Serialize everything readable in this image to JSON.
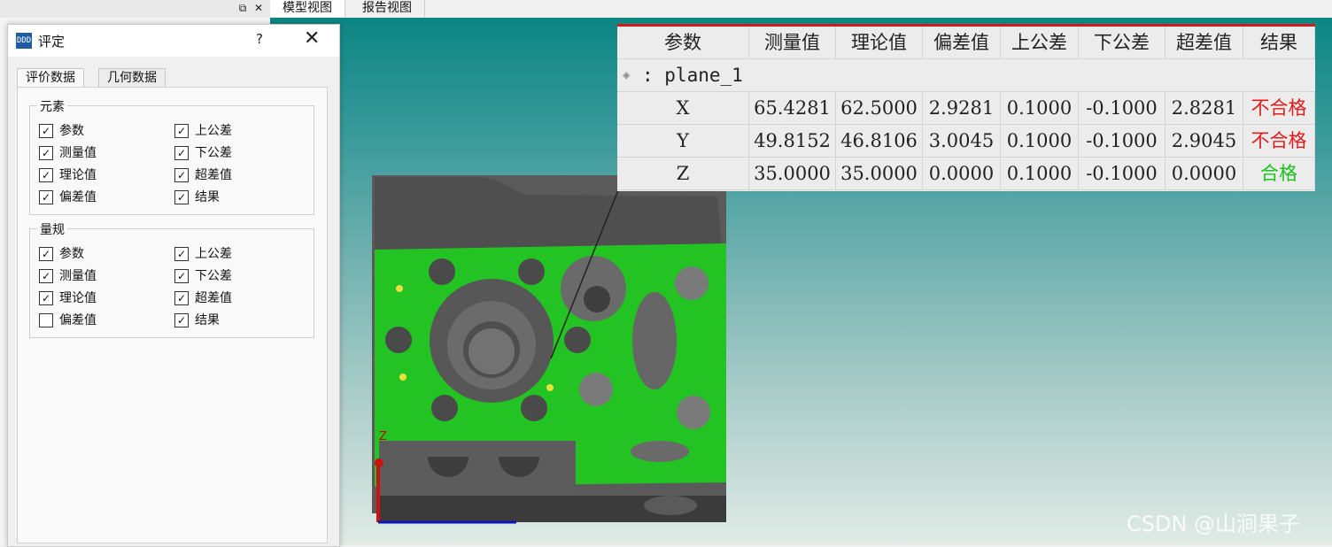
{
  "view_tabs": [
    "模型视图",
    "报告视图"
  ],
  "dock": {
    "restore_icon": "restore-icon",
    "close_icon": "close-icon"
  },
  "dialog": {
    "title": "评定",
    "help": "?",
    "tabs": [
      "评价数据",
      "几何数据"
    ],
    "element_group": {
      "title": "元素",
      "items": [
        {
          "label": "参数",
          "checked": true
        },
        {
          "label": "测量值",
          "checked": true
        },
        {
          "label": "理论值",
          "checked": true
        },
        {
          "label": "偏差值",
          "checked": true
        },
        {
          "label": "上公差",
          "checked": true
        },
        {
          "label": "下公差",
          "checked": true
        },
        {
          "label": "超差值",
          "checked": true
        },
        {
          "label": "结果",
          "checked": true
        }
      ]
    },
    "gauge_group": {
      "title": "量规",
      "items": [
        {
          "label": "参数",
          "checked": true
        },
        {
          "label": "测量值",
          "checked": true
        },
        {
          "label": "理论值",
          "checked": true
        },
        {
          "label": "偏差值",
          "checked": false
        },
        {
          "label": "上公差",
          "checked": true
        },
        {
          "label": "下公差",
          "checked": true
        },
        {
          "label": "超差值",
          "checked": true
        },
        {
          "label": "结果",
          "checked": true
        }
      ]
    }
  },
  "result_table": {
    "headers": [
      "参数",
      "测量值",
      "理论值",
      "偏差值",
      "上公差",
      "下公差",
      "超差值",
      "结果"
    ],
    "feature": ": plane_1",
    "rows": [
      [
        "X",
        "65.4281",
        "62.5000",
        "2.9281",
        "0.1000",
        "-0.1000",
        "2.8281",
        "不合格"
      ],
      [
        "Y",
        "49.8152",
        "46.8106",
        "3.0045",
        "0.1000",
        "-0.1000",
        "2.9045",
        "不合格"
      ],
      [
        "Z",
        "35.0000",
        "35.0000",
        "0.0000",
        "0.1000",
        "-0.1000",
        "0.0000",
        "合格"
      ]
    ],
    "result_colors": {
      "fail": "#e31b1b",
      "pass": "#19c319"
    }
  },
  "axis_label": "Z",
  "watermark": "CSDN @山涧果子"
}
